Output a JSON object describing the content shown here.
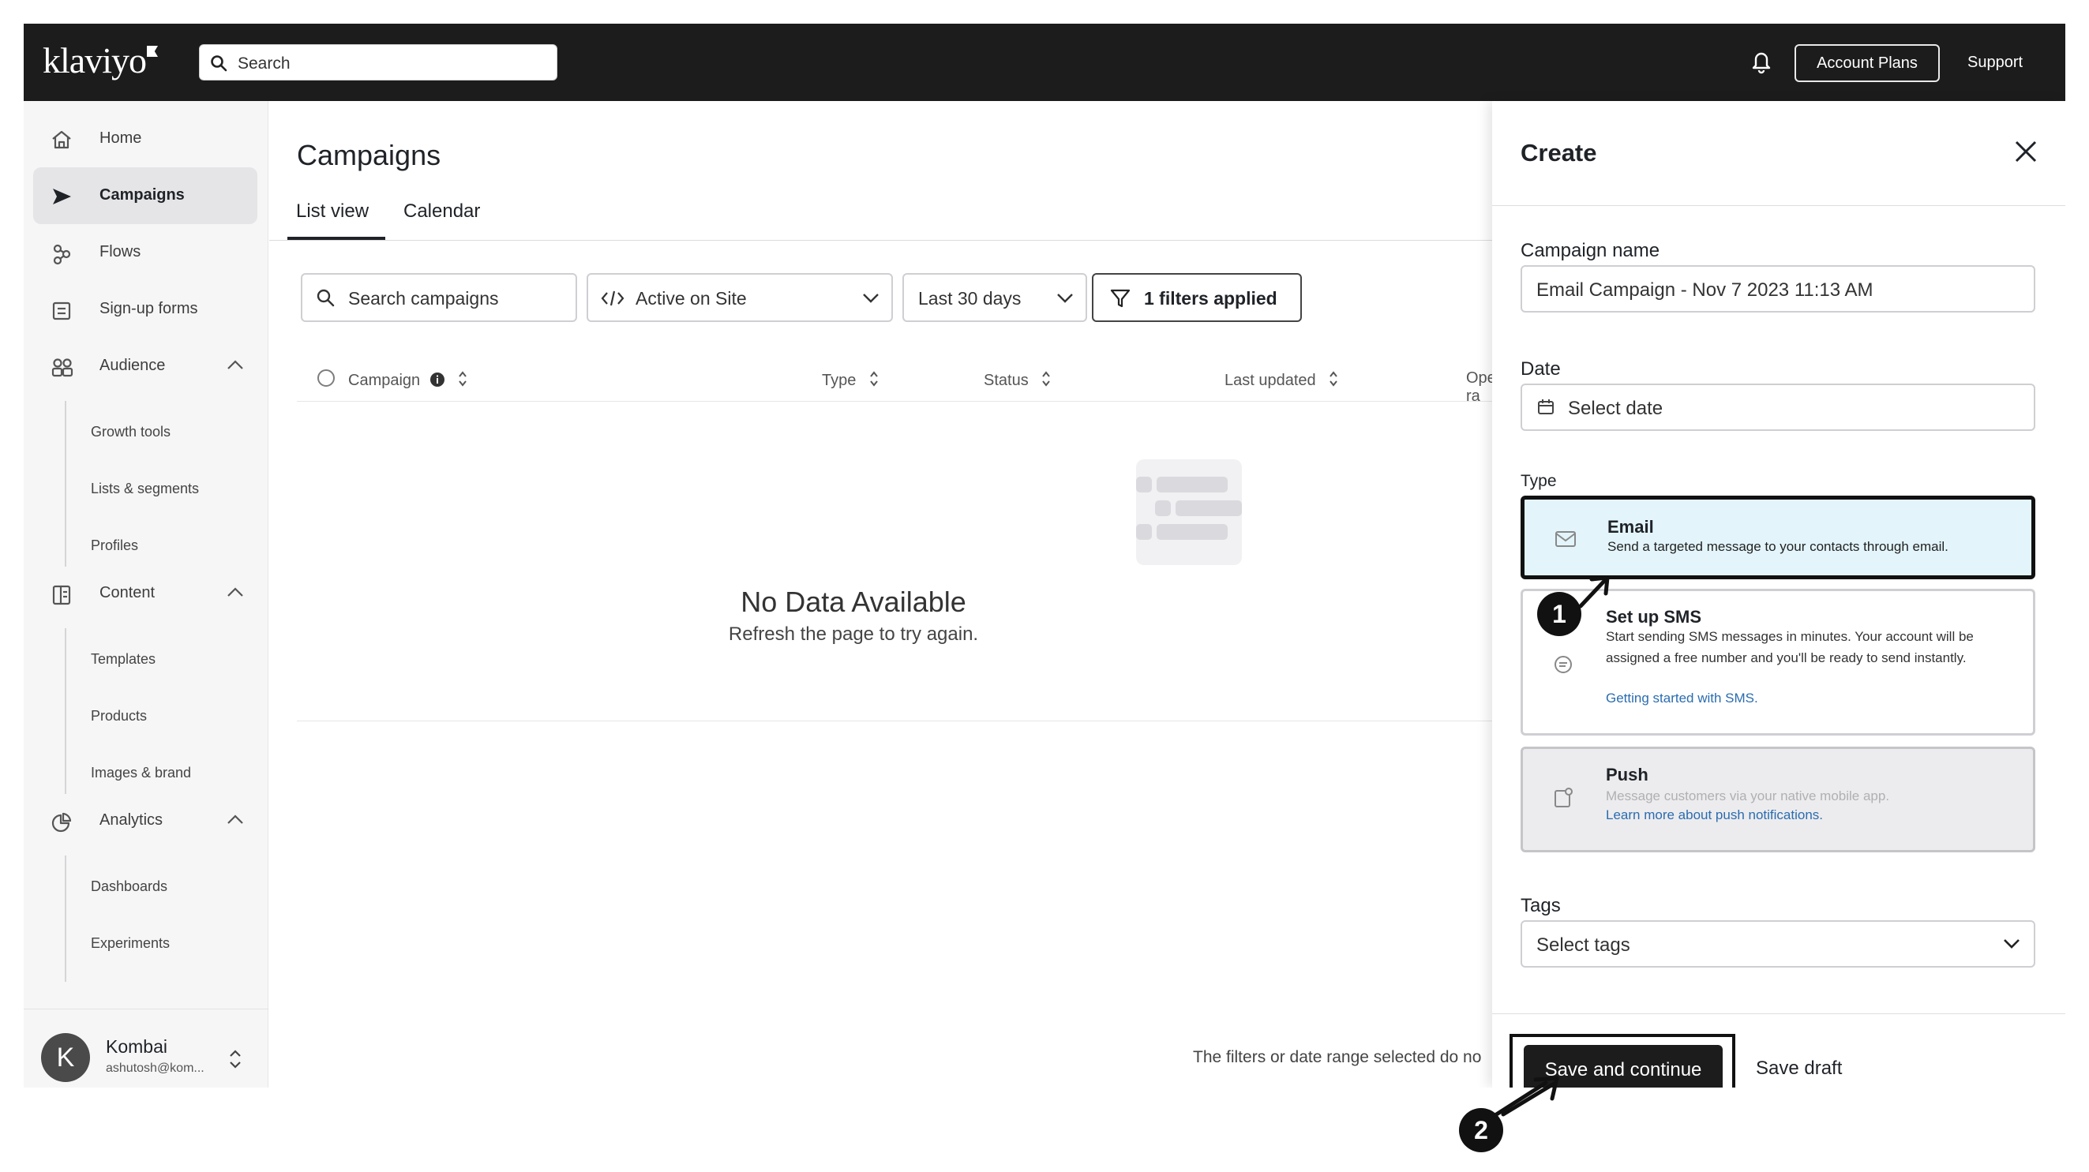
{
  "topbar": {
    "logo": "klaviyo",
    "search_placeholder": "Search",
    "account_plans": "Account Plans",
    "support": "Support"
  },
  "sidebar": {
    "items": [
      {
        "label": "Home",
        "icon": "home-icon"
      },
      {
        "label": "Campaigns",
        "icon": "send-icon",
        "active": true
      },
      {
        "label": "Flows",
        "icon": "flows-icon"
      },
      {
        "label": "Sign-up forms",
        "icon": "form-icon"
      },
      {
        "label": "Audience",
        "icon": "audience-icon",
        "expanded": true,
        "children": [
          "Growth tools",
          "Lists & segments",
          "Profiles"
        ]
      },
      {
        "label": "Content",
        "icon": "content-icon",
        "expanded": true,
        "children": [
          "Templates",
          "Products",
          "Images & brand"
        ]
      },
      {
        "label": "Analytics",
        "icon": "analytics-icon",
        "expanded": true,
        "children": [
          "Dashboards",
          "Experiments"
        ]
      }
    ],
    "user": {
      "initial": "K",
      "name": "Kombai",
      "email": "ashutosh@kom..."
    }
  },
  "main": {
    "title": "Campaigns",
    "tabs": [
      {
        "label": "List view",
        "active": true
      },
      {
        "label": "Calendar"
      }
    ],
    "filters": {
      "search_placeholder": "Search campaigns",
      "active_on_site": "Active on Site",
      "date_range": "Last 30 days",
      "filters_applied": "1 filters applied"
    },
    "table_headers": [
      "Campaign",
      "Type",
      "Status",
      "Last updated",
      "Open ra"
    ],
    "empty_title": "No Data Available",
    "empty_subtitle": "Refresh the page to try again.",
    "footnote": "The filters or date range selected do no"
  },
  "create_panel": {
    "title": "Create",
    "campaign_name_label": "Campaign name",
    "campaign_name_value": "Email Campaign - Nov 7 2023 11:13 AM",
    "date_label": "Date",
    "date_placeholder": "Select date",
    "type_label": "Type",
    "types": [
      {
        "title": "Email",
        "description": "Send a targeted message to your contacts through email.",
        "selected": true
      },
      {
        "title": "Set up SMS",
        "description": "Start sending SMS messages in minutes. Your account will be assigned a free number and you'll be ready to send instantly.",
        "link": "Getting started with SMS."
      },
      {
        "title": "Push",
        "description": "Message customers via your native mobile app.",
        "link": "Learn more about push notifications.",
        "disabled": true
      }
    ],
    "tags_label": "Tags",
    "tags_placeholder": "Select tags",
    "save_continue": "Save and continue",
    "save_draft": "Save draft"
  },
  "annotations": {
    "step1": "1",
    "step2": "2"
  },
  "colors": {
    "topbar_bg": "#1c1c1c",
    "selected_card_bg": "#e3f5fb",
    "link": "#2b6cb0",
    "sidebar_bg": "#f6f6f7"
  }
}
